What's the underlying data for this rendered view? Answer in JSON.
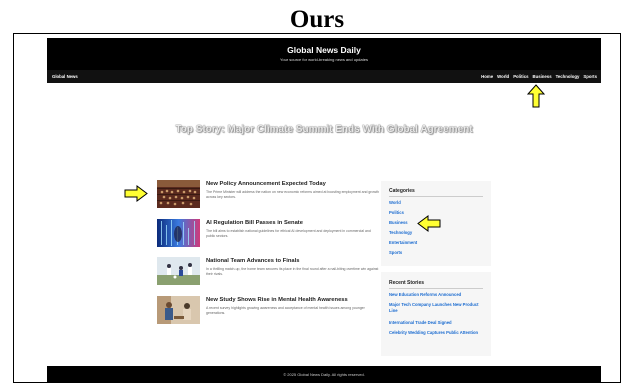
{
  "heading": "Ours",
  "site": {
    "title": "Global News Daily",
    "tagline": "Your source for world-breaking news and updates"
  },
  "nav": {
    "brand": "Global News",
    "links": [
      "Home",
      "World",
      "Politics",
      "Business",
      "Technology",
      "Sports"
    ]
  },
  "hero": {
    "title": "Top Story: Major Climate Summit Ends With Global Agreement"
  },
  "stories": [
    {
      "title": "New Policy Announcement Expected Today",
      "desc": "The Prime Minister will address the nation on new economic reforms aimed at boosting employment and growth across key sectors.",
      "thumb": "parliament-image"
    },
    {
      "title": "AI Regulation Bill Passes in Senate",
      "desc": "The bill aims to establish national guidelines for ethical AI development and deployment in commercial and public sectors.",
      "thumb": "ai-tech-image"
    },
    {
      "title": "National Team Advances to Finals",
      "desc": "In a thrilling match-up, the home team secures its place in the final round after a nail-biting overtime win against their rivals.",
      "thumb": "sports-image"
    },
    {
      "title": "New Study Shows Rise in Mental Health Awareness",
      "desc": "A recent survey highlights growing awareness and acceptance of mental health issues among younger generations.",
      "thumb": "counseling-image"
    }
  ],
  "categories": {
    "title": "Categories",
    "items": [
      "World",
      "Politics",
      "Business",
      "Technology",
      "Entertainment",
      "Sports"
    ]
  },
  "recent": {
    "title": "Recent Stories",
    "items": [
      "New Education Reforms Announced",
      "Major Tech Company Launches New Product Line",
      "International Trade Deal Signed",
      "Celebrity Wedding Captures Public Attention"
    ]
  },
  "footer": {
    "text": "© 2025 Global News Daily. All rights reserved."
  },
  "colors": {
    "header_bg": "#000000",
    "link": "#1a6bd0",
    "arrow_fill": "#ffff33",
    "arrow_stroke": "#000000"
  }
}
